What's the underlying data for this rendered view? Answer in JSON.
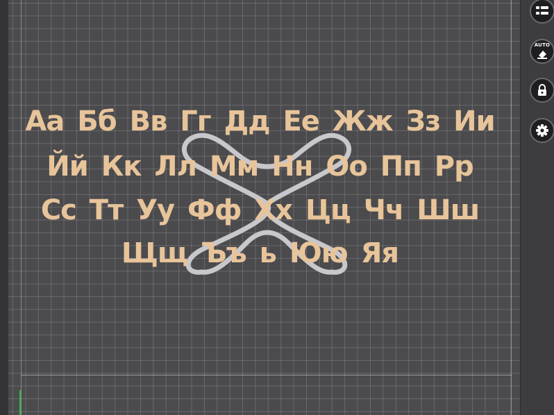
{
  "viewport": {
    "canvas_color": "#4a4a4d",
    "grid_line_color": "#6b6b6e",
    "text_color": "#e8c49a",
    "shape_color": "#c8c8cc",
    "axis_color": "#2fbf3f"
  },
  "model_text": {
    "rows": [
      "Аа Бб Вв Гг Дд Ее Жж Зз Ии",
      "Йй Кк Лл Мм Нн Оо Пп Рр",
      "Сс Тт Уу Фф Хх Цц Чч Шш",
      "Щщ Ъъ ь Юю Яя"
    ]
  },
  "toolbar": {
    "buttons": [
      {
        "name": "list-icon"
      },
      {
        "name": "auto-orient-icon",
        "label": "AUTO"
      },
      {
        "name": "lock-icon"
      },
      {
        "name": "gear-icon"
      }
    ]
  }
}
